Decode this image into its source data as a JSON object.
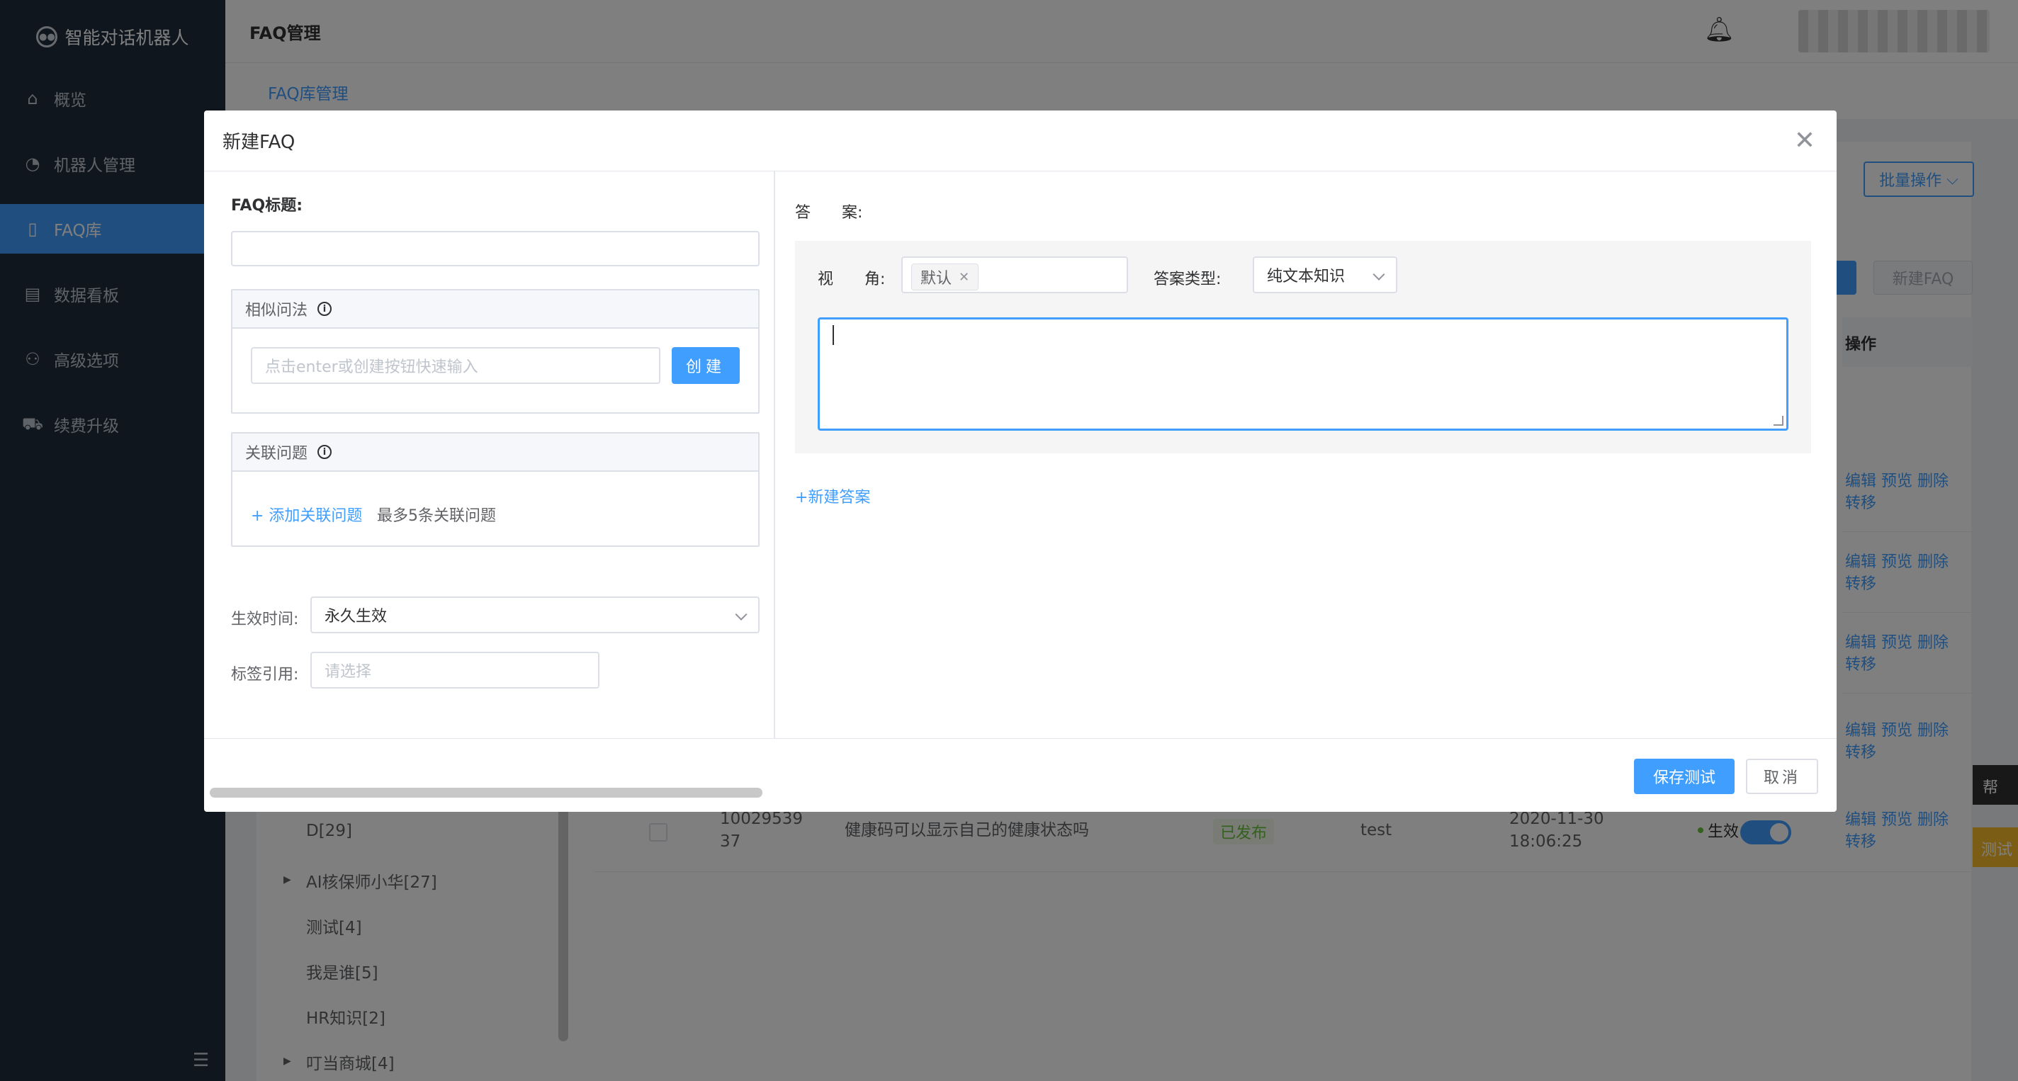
{
  "sidebar": {
    "brand": "智能对话机器人",
    "items": [
      {
        "label": "概览",
        "icon": "home-icon"
      },
      {
        "label": "机器人管理",
        "icon": "robot-icon"
      },
      {
        "label": "FAQ库",
        "icon": "book-icon"
      },
      {
        "label": "数据看板",
        "icon": "dashboard-icon"
      },
      {
        "label": "高级选项",
        "icon": "users-icon"
      },
      {
        "label": "续费升级",
        "icon": "cart-icon"
      }
    ]
  },
  "header": {
    "title": "FAQ管理"
  },
  "breadcrumb": {
    "current": "FAQ库管理"
  },
  "toolbar": {
    "batch_label": "批量操作",
    "new_faq_label": "新建FAQ"
  },
  "table": {
    "op_header": "操作",
    "op_actions": "编辑 预览 删除",
    "op_transfer": "转移",
    "row": {
      "id_line1": "10029539",
      "id_line2": "37",
      "question": "健康码可以显示自己的健康状态吗",
      "status": "已发布",
      "author": "test",
      "date": "2020-11-30",
      "time": "18:06:25",
      "effect": "生效"
    }
  },
  "tree": {
    "items": [
      "D[29]",
      "AI核保师小华[27]",
      "测试[4]",
      "我是谁[5]",
      "HR知识[2]",
      "叮当商城[4]"
    ]
  },
  "side_tabs": {
    "help": "帮",
    "test": "测试"
  },
  "modal": {
    "title": "新建FAQ",
    "faq_title_label": "FAQ标题:",
    "faq_title_value": "",
    "similar_label": "相似问法",
    "similar_placeholder": "点击enter或创建按钮快速输入",
    "create_label": "创建",
    "related_label": "关联问题",
    "add_related_label": "+ 添加关联问题",
    "related_hint": "最多5条关联问题",
    "effective_label": "生效时间:",
    "effective_value": "永久生效",
    "tag_label": "标签引用:",
    "tag_placeholder": "请选择",
    "answer_label": "答　　案:",
    "view_label": "视　　角:",
    "view_tag": "默认",
    "answer_type_label": "答案类型:",
    "answer_type_value": "纯文本知识",
    "new_answer_label": "+新建答案",
    "save_label": "保存测试",
    "cancel_label": "取消"
  }
}
